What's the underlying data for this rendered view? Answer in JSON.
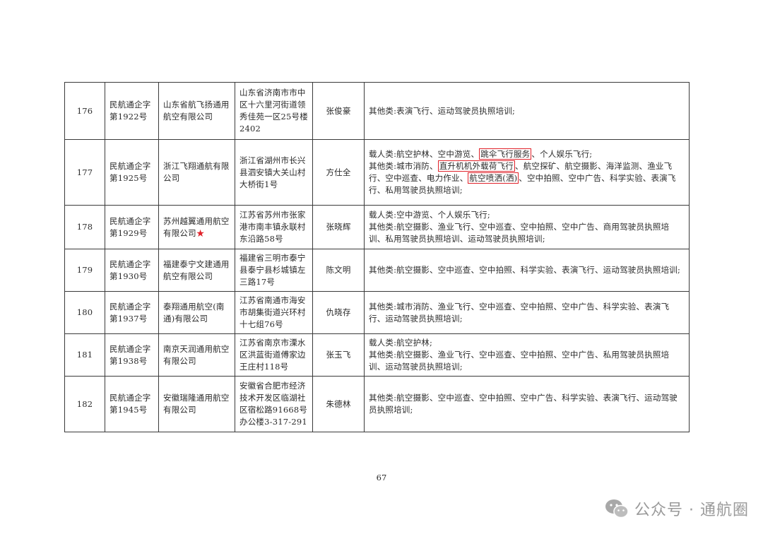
{
  "rows": [
    {
      "no": "176",
      "permit": "民航通企字第1922号",
      "company": "山东省航飞扬通用航空有限公司",
      "address": "山东省济南市市中区十六里河街道领秀佳苑一区25号楼2402",
      "rep": "张俊豪",
      "scope": [
        {
          "segments": [
            {
              "text": "其他类:表演飞行、运动驾驶员执照培训;"
            }
          ]
        }
      ]
    },
    {
      "no": "177",
      "permit": "民航通企字第1925号",
      "company": "浙江飞翔通航有限公司",
      "address": "浙江省湖州市长兴县泗安镇大关山村大桥街1号",
      "rep": "方仕全",
      "scope": [
        {
          "segments": [
            {
              "text": "载人类:航空护林、空中游览、"
            },
            {
              "text": "跳伞飞行服务",
              "hl": true
            },
            {
              "text": "、个人娱乐飞行;"
            }
          ]
        },
        {
          "segments": [
            {
              "text": "其他类:城市消防、"
            },
            {
              "text": "直升机机外载荷飞行",
              "hl": true
            },
            {
              "text": "、航空探矿、航空摄影、海洋监测、渔业飞行、空中巡查、电力作业、"
            },
            {
              "text": "航空喷洒(洒)",
              "hl": true
            },
            {
              "text": "、空中拍照、空中广告、科学实验、表演飞行、私用驾驶员执照培训;"
            }
          ]
        }
      ]
    },
    {
      "no": "178",
      "permit": "民航通企字第1929号",
      "company": "苏州越翼通用航空有限公司",
      "company_star": "★",
      "address": "江苏省苏州市张家港市南丰镇永联村东沿路58号",
      "rep": "张晓辉",
      "scope": [
        {
          "segments": [
            {
              "text": "载人类:空中游览、个人娱乐飞行;"
            }
          ]
        },
        {
          "segments": [
            {
              "text": "其他类:航空摄影、渔业飞行、空中巡查、空中拍照、空中广告、商用驾驶员执照培训、私用驾驶员执照培训、运动驾驶员执照培训;"
            }
          ]
        }
      ]
    },
    {
      "no": "179",
      "permit": "民航通企字第1930号",
      "company": "福建泰宁文建通用航空有限公司",
      "address": "福建省三明市泰宁县泰宁县杉城镇左三路17号",
      "rep": "陈文明",
      "scope": [
        {
          "segments": [
            {
              "text": "其他类:航空摄影、空中巡查、空中拍照、科学实验、表演飞行、运动驾驶员执照培训;"
            }
          ]
        }
      ]
    },
    {
      "no": "180",
      "permit": "民航通企字第1937号",
      "company": "泰翔通用航空(南通)有限公司",
      "address": "江苏省南通市海安市胡集街道兴环村十七组76号",
      "rep": "仇晓存",
      "scope": [
        {
          "segments": [
            {
              "text": "其他类:城市消防、渔业飞行、空中巡查、空中拍照、空中广告、科学实验、表演飞行、运动驾驶员执照培训;"
            }
          ]
        }
      ]
    },
    {
      "no": "181",
      "permit": "民航通企字第1938号",
      "company": "南京天润通用航空有限公司",
      "address": "江苏省南京市溧水区洪蓝街道傅家边王庄村118号",
      "rep": "张玉飞",
      "scope": [
        {
          "segments": [
            {
              "text": "载人类:航空护林;"
            }
          ]
        },
        {
          "segments": [
            {
              "text": "其他类:航空摄影、渔业飞行、空中巡查、空中拍照、空中广告、私用驾驶员执照培训、运动驾驶员执照培训;"
            }
          ]
        }
      ]
    },
    {
      "no": "182",
      "permit": "民航通企字第1945号",
      "company": "安徽瑞隆通用航空有限公司",
      "address": "安徽省合肥市经济技术开发区临湖社区宿松路91668号办公楼3-317-291",
      "rep": "朱德林",
      "scope": [
        {
          "segments": [
            {
              "text": "其他类:航空摄影、空中巡查、空中拍照、空中广告、科学实验、表演飞行、运动驾驶员执照培训;"
            }
          ]
        }
      ]
    }
  ],
  "page_number": "67",
  "watermark": {
    "icon": "wechat-icon",
    "text": "公众号 · 通航圈",
    "color": "#9a9a9a"
  },
  "colors": {
    "highlight_border": "#e0222a",
    "star": "#e0222a",
    "table_border": "#3a3a3a"
  }
}
